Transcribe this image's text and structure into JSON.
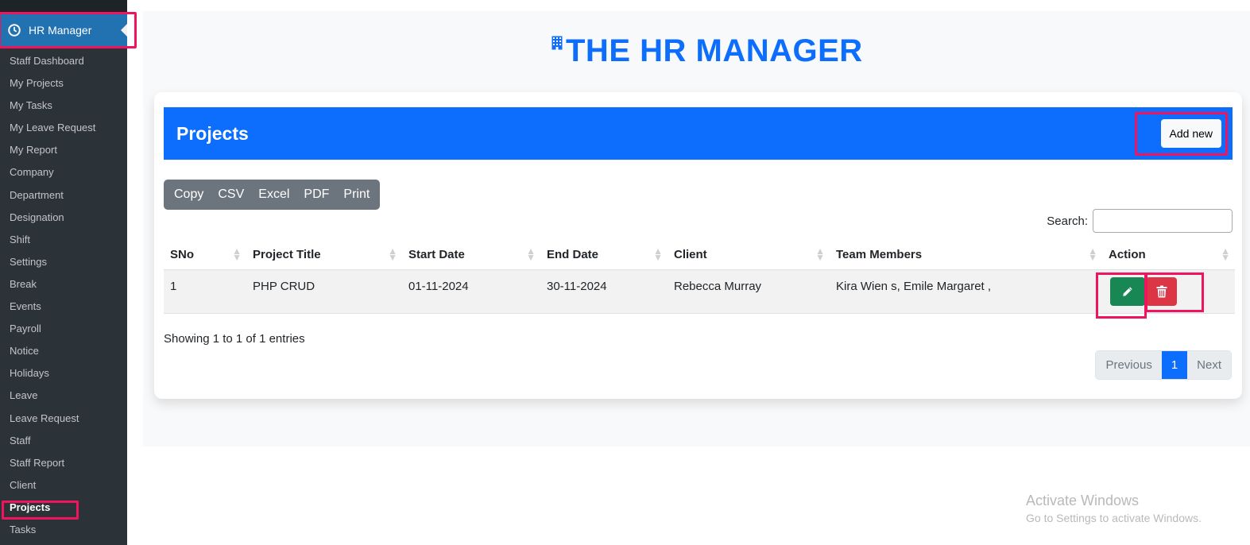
{
  "sidebar": {
    "header": {
      "label": "HR Manager",
      "icon": "clock-icon"
    },
    "items": [
      {
        "label": "Staff Dashboard"
      },
      {
        "label": "My Projects"
      },
      {
        "label": "My Tasks"
      },
      {
        "label": "My Leave Request"
      },
      {
        "label": "My Report"
      },
      {
        "label": "Company"
      },
      {
        "label": "Department"
      },
      {
        "label": "Designation"
      },
      {
        "label": "Shift"
      },
      {
        "label": "Settings"
      },
      {
        "label": "Break"
      },
      {
        "label": "Events"
      },
      {
        "label": "Payroll"
      },
      {
        "label": "Notice"
      },
      {
        "label": "Holidays"
      },
      {
        "label": "Leave"
      },
      {
        "label": "Leave Request"
      },
      {
        "label": "Staff"
      },
      {
        "label": "Staff Report"
      },
      {
        "label": "Client"
      },
      {
        "label": "Projects",
        "active": true
      },
      {
        "label": "Tasks"
      }
    ]
  },
  "page": {
    "title": "THE HR MANAGER",
    "title_icon": "building-icon",
    "accent_color": "#0d6efd"
  },
  "card": {
    "title": "Projects",
    "add_button": "Add new",
    "export_buttons": [
      "Copy",
      "CSV",
      "Excel",
      "PDF",
      "Print"
    ],
    "search": {
      "label": "Search:",
      "value": "",
      "placeholder": ""
    },
    "table": {
      "columns": [
        "SNo",
        "Project Title",
        "Start Date",
        "End Date",
        "Client",
        "Team Members",
        "Action"
      ],
      "rows": [
        {
          "sno": "1",
          "title": "PHP CRUD",
          "start": "01-11-2024",
          "end": "30-11-2024",
          "client": "Rebecca Murray",
          "team": "Kira Wien s, Emile Margaret ,",
          "actions": [
            "edit-icon",
            "trash-icon"
          ]
        }
      ]
    },
    "info": "Showing 1 to 1 of 1 entries",
    "pagination": {
      "previous": "Previous",
      "current": "1",
      "next": "Next"
    }
  },
  "watermark": {
    "line1": "Activate Windows",
    "line2": "Go to Settings to activate Windows."
  }
}
